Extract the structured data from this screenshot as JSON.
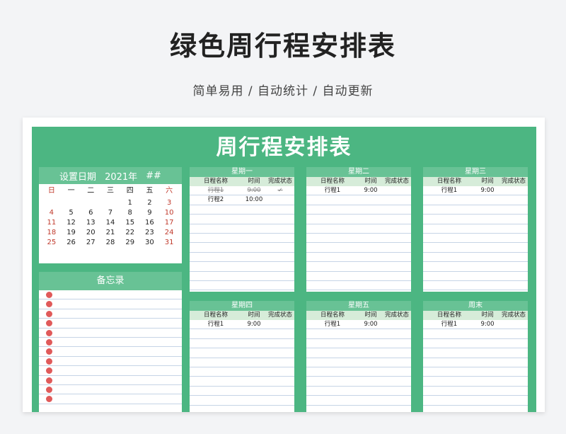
{
  "header": {
    "title": "绿色周行程安排表",
    "subtitle": "简单易用 / 自动统计 / 自动更新"
  },
  "board": {
    "title": "周行程安排表"
  },
  "calendar": {
    "label": "设置日期",
    "year": "2021年",
    "month": "##",
    "weekdays": [
      "日",
      "一",
      "二",
      "三",
      "四",
      "五",
      "六"
    ],
    "weeks": [
      [
        "",
        "",
        "",
        "",
        "1",
        "2",
        "3"
      ],
      [
        "4",
        "5",
        "6",
        "7",
        "8",
        "9",
        "10"
      ],
      [
        "11",
        "12",
        "13",
        "14",
        "15",
        "16",
        "17"
      ],
      [
        "18",
        "19",
        "20",
        "21",
        "22",
        "23",
        "24"
      ],
      [
        "25",
        "26",
        "27",
        "28",
        "29",
        "30",
        "31"
      ]
    ],
    "weekend_color": "#c0392b"
  },
  "memo": {
    "title": "备忘录",
    "line_count": 12,
    "dot_color": "#e05a5a"
  },
  "columns": {
    "name": "日程名称",
    "time": "时间",
    "status": "完成状态"
  },
  "days": [
    {
      "label": "星期一",
      "rows": [
        {
          "name": "行程1",
          "time": "9:00",
          "status": "✓",
          "done": true
        },
        {
          "name": "行程2",
          "time": "10:00",
          "status": "",
          "done": false
        }
      ]
    },
    {
      "label": "星期二",
      "rows": [
        {
          "name": "行程1",
          "time": "9:00",
          "status": "",
          "done": false
        }
      ]
    },
    {
      "label": "星期三",
      "rows": [
        {
          "name": "行程1",
          "time": "9:00",
          "status": "",
          "done": false
        }
      ]
    },
    {
      "label": "星期四",
      "rows": [
        {
          "name": "行程1",
          "time": "9:00",
          "status": "",
          "done": false
        }
      ]
    },
    {
      "label": "星期五",
      "rows": [
        {
          "name": "行程1",
          "time": "9:00",
          "status": "",
          "done": false
        }
      ]
    },
    {
      "label": "周末",
      "rows": [
        {
          "name": "行程1",
          "time": "9:00",
          "status": "",
          "done": false
        }
      ]
    }
  ],
  "colors": {
    "board": "#4cb682",
    "header_band": "#68c295",
    "column_band": "#d6ecd9"
  }
}
